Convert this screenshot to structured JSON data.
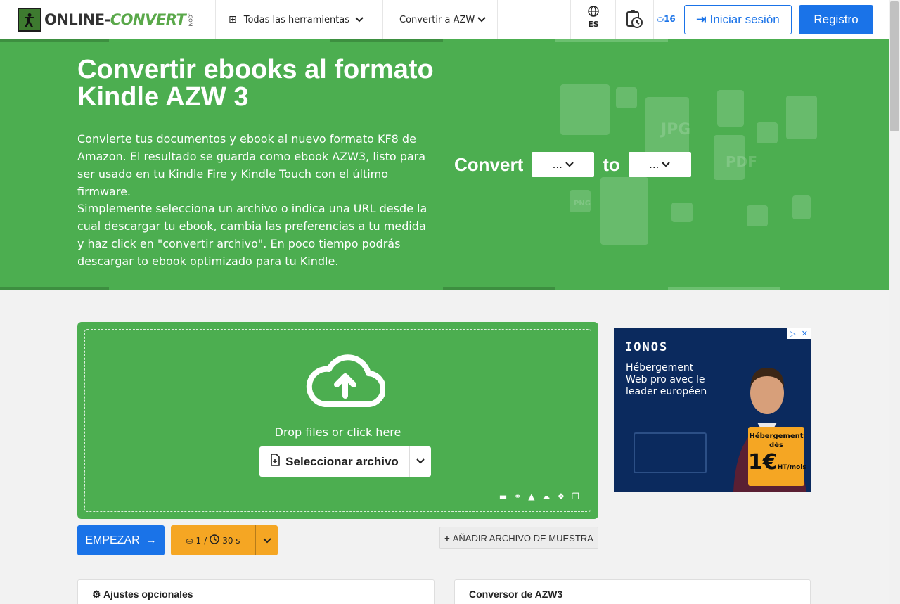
{
  "header": {
    "logo_text": "ONLINE-",
    "logo_accent": "CONVERT",
    "logo_suffix": ".COM",
    "nav_tools": "Todas las herramientas",
    "nav_convert": "Convertir a AZW",
    "language": "ES",
    "credits": "16",
    "login_label": "Iniciar sesión",
    "register_label": "Registro"
  },
  "hero": {
    "title": "Convertir ebooks al formato Kindle AZW 3",
    "paragraph1": "Convierte tus documentos y ebook al nuevo formato KF8 de Amazon. El resultado se guarda como ebook AZW3, listo para ser usado en tu Kindle Fire y Kindle Touch con el último firmware.",
    "paragraph2": "Simplemente selecciona un archivo o indica una URL desde la cual descargar tu ebook, cambia las preferencias a tu medida y haz click en \"convertir archivo\". En poco tiempo podrás descargar to ebook optimizado para tu Kindle.",
    "convert_word": "Convert",
    "to_word": "to",
    "from_select": "...",
    "to_select": "...",
    "deco_labels": [
      "JPG",
      "PDF",
      "PNG"
    ]
  },
  "upload": {
    "drop_text": "Drop files or click here",
    "select_button": "Seleccionar archivo",
    "source_icons": [
      "folder-icon",
      "link-icon",
      "google-drive-icon",
      "onedrive-icon",
      "dropbox-icon",
      "clipboard-icon"
    ]
  },
  "actions": {
    "start_label": "EMPEZAR",
    "credit_count": "1",
    "separator": "/",
    "time_label": "30 s",
    "sample_label": "AÑADIR ARCHIVO DE MUESTRA"
  },
  "ad": {
    "brand": "IONOS",
    "text": "Hébergement Web pro avec le leader européen",
    "price_line1": "Hébergement dès",
    "price_value": "1€",
    "price_unit": "HT/mois"
  },
  "panels": {
    "left_title": "Ajustes opcionales",
    "right_title": "Conversor de AZW3"
  },
  "colors": {
    "brand_green": "#4cae50",
    "primary_blue": "#1a73e8",
    "credit_orange": "#f5a623"
  }
}
